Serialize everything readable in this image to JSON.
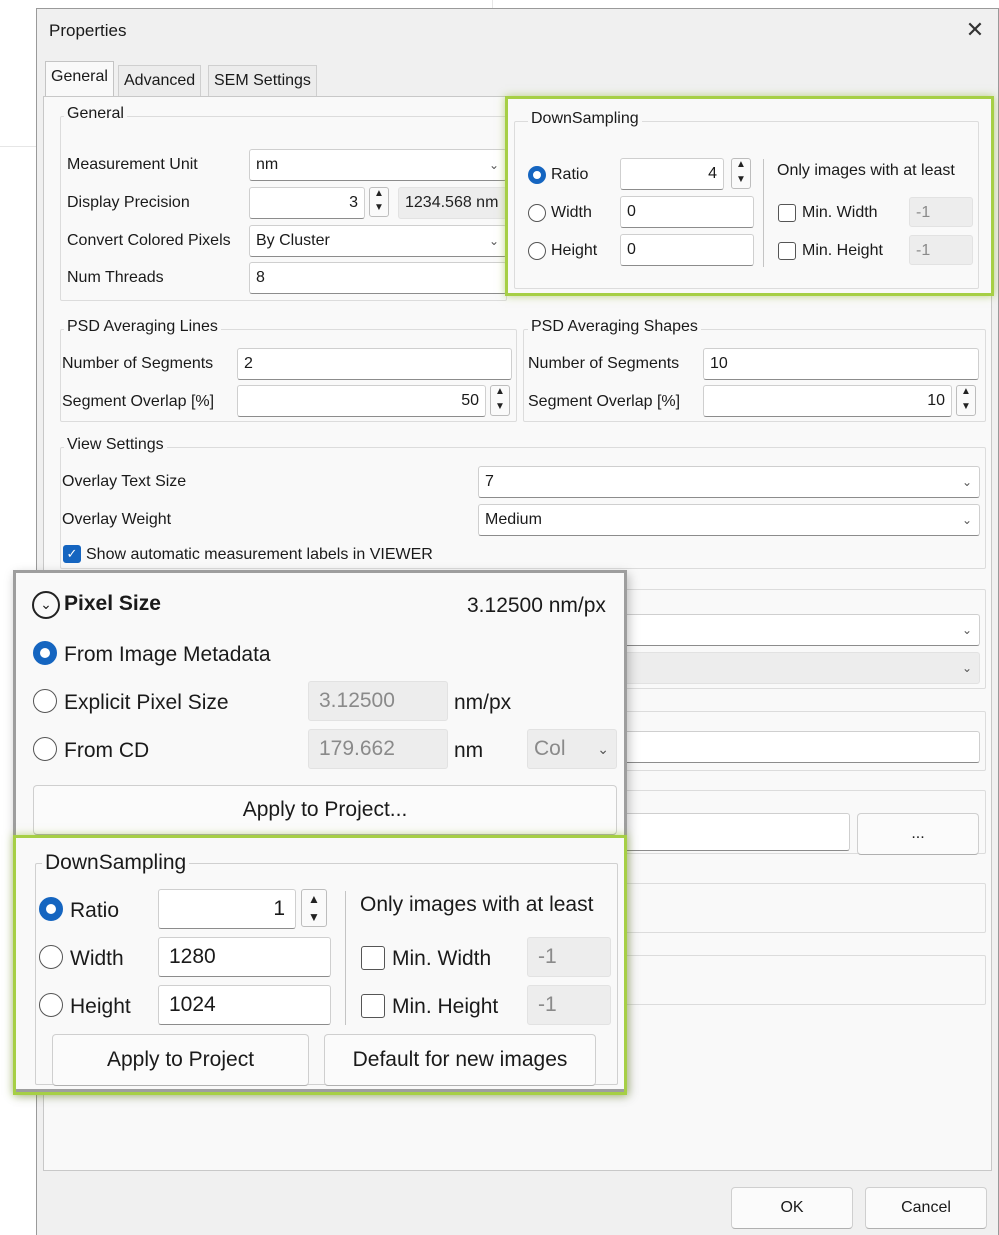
{
  "dialog": {
    "title": "Properties",
    "close_glyph": "✕",
    "tabs": [
      "General",
      "Advanced",
      "SEM Settings"
    ],
    "ok_label": "OK",
    "cancel_label": "Cancel"
  },
  "general": {
    "title": "General",
    "measurement_unit": {
      "label": "Measurement Unit",
      "value": "nm"
    },
    "display_precision": {
      "label": "Display Precision",
      "value": "3",
      "preview": "1234.568 nm"
    },
    "convert_colored": {
      "label": "Convert Colored Pixels",
      "value": "By Cluster"
    },
    "num_threads": {
      "label": "Num Threads",
      "value": "8"
    }
  },
  "downsampling_top": {
    "title": "DownSampling",
    "ratio": {
      "label": "Ratio",
      "value": "4",
      "selected": true
    },
    "width": {
      "label": "Width",
      "value": "0"
    },
    "height": {
      "label": "Height",
      "value": "0"
    },
    "only_label": "Only images with at least",
    "min_width": {
      "label": "Min. Width",
      "value": "-1"
    },
    "min_height": {
      "label": "Min. Height",
      "value": "-1"
    }
  },
  "psd_lines": {
    "title": "PSD Averaging Lines",
    "segments": {
      "label": "Number of Segments",
      "value": "2"
    },
    "overlap": {
      "label": "Segment Overlap [%]",
      "value": "50"
    }
  },
  "psd_shapes": {
    "title": "PSD Averaging Shapes",
    "segments": {
      "label": "Number of Segments",
      "value": "10"
    },
    "overlap": {
      "label": "Segment Overlap [%]",
      "value": "10"
    }
  },
  "view": {
    "title": "View Settings",
    "text_size": {
      "label": "Overlay Text Size",
      "value": "7"
    },
    "weight": {
      "label": "Overlay Weight",
      "value": "Medium"
    },
    "show_labels": {
      "label": "Show automatic measurement labels in VIEWER",
      "checked": true
    },
    "more_button": "..."
  },
  "pixel_size": {
    "title": "Pixel Size",
    "value": "3.12500 nm/px",
    "from_metadata": {
      "label": "From Image Metadata",
      "selected": true
    },
    "explicit": {
      "label": "Explicit Pixel Size",
      "value": "3.12500",
      "unit": "nm/px"
    },
    "from_cd": {
      "label": "From CD",
      "value": "179.662",
      "unit": "nm",
      "select": "Col"
    },
    "apply_button": "Apply to Project..."
  },
  "downsampling_panel": {
    "title": "DownSampling",
    "ratio": {
      "label": "Ratio",
      "value": "1",
      "selected": true
    },
    "width": {
      "label": "Width",
      "value": "1280"
    },
    "height": {
      "label": "Height",
      "value": "1024"
    },
    "only_label": "Only images with at least",
    "min_width": {
      "label": "Min. Width",
      "value": "-1"
    },
    "min_height": {
      "label": "Min. Height",
      "value": "-1"
    },
    "apply_button": "Apply to Project",
    "default_button": "Default for new images"
  },
  "colors": {
    "accent": "#1565c0",
    "highlight": "#a6cf45"
  }
}
